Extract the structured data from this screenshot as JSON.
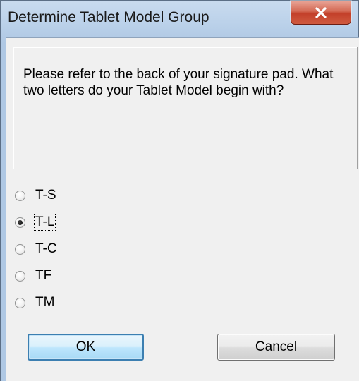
{
  "window": {
    "title": "Determine Tablet Model Group",
    "close_icon": "close-x-icon"
  },
  "message": {
    "text": "Please refer to the back of your signature pad. What two letters do your Tablet Model begin with?"
  },
  "radio_options": [
    {
      "label": "T-S",
      "checked": false
    },
    {
      "label": "T-L",
      "checked": true
    },
    {
      "label": "T-C",
      "checked": false
    },
    {
      "label": "TF",
      "checked": false
    },
    {
      "label": "TM",
      "checked": false
    }
  ],
  "buttons": {
    "ok_label": "OK",
    "cancel_label": "Cancel"
  },
  "colors": {
    "title_bar": "#bcd2ea",
    "close_button": "#c3402a",
    "dialog_background": "#f0f0f0"
  }
}
